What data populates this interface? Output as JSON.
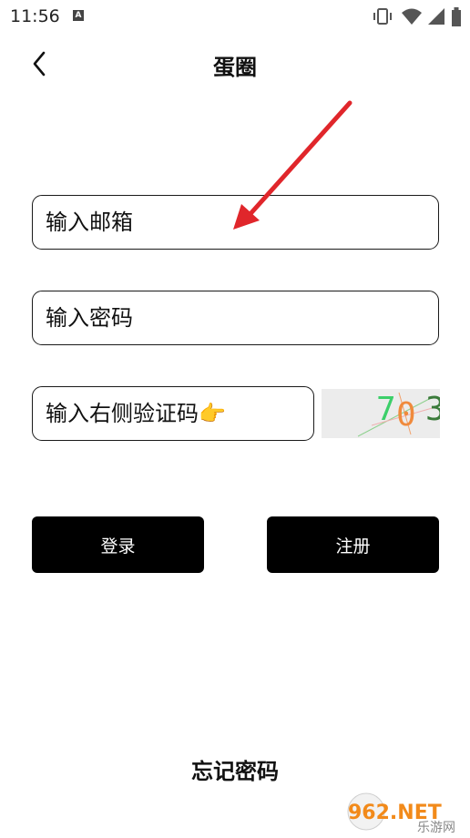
{
  "status": {
    "time": "11:56",
    "badge": "A",
    "icons": [
      "vibrate-icon",
      "wifi-icon",
      "signal-icon",
      "battery-icon"
    ]
  },
  "header": {
    "title": "蛋圈",
    "back_icon": "chevron-left-icon"
  },
  "form": {
    "email_placeholder": "输入邮箱",
    "password_placeholder": "输入密码",
    "captcha_placeholder": "输入右侧验证码👉",
    "captcha_text": [
      "7",
      "0",
      "3"
    ],
    "captcha_colors": [
      "#3ccf6a",
      "#f08a3c",
      "#3a7a3a"
    ]
  },
  "buttons": {
    "login": "登录",
    "register": "注册"
  },
  "links": {
    "forgot": "忘记密码"
  },
  "watermark": {
    "main": "962.NET",
    "sub": "乐游网"
  },
  "colors": {
    "accent": "#000000",
    "arrow": "#e0262b"
  }
}
